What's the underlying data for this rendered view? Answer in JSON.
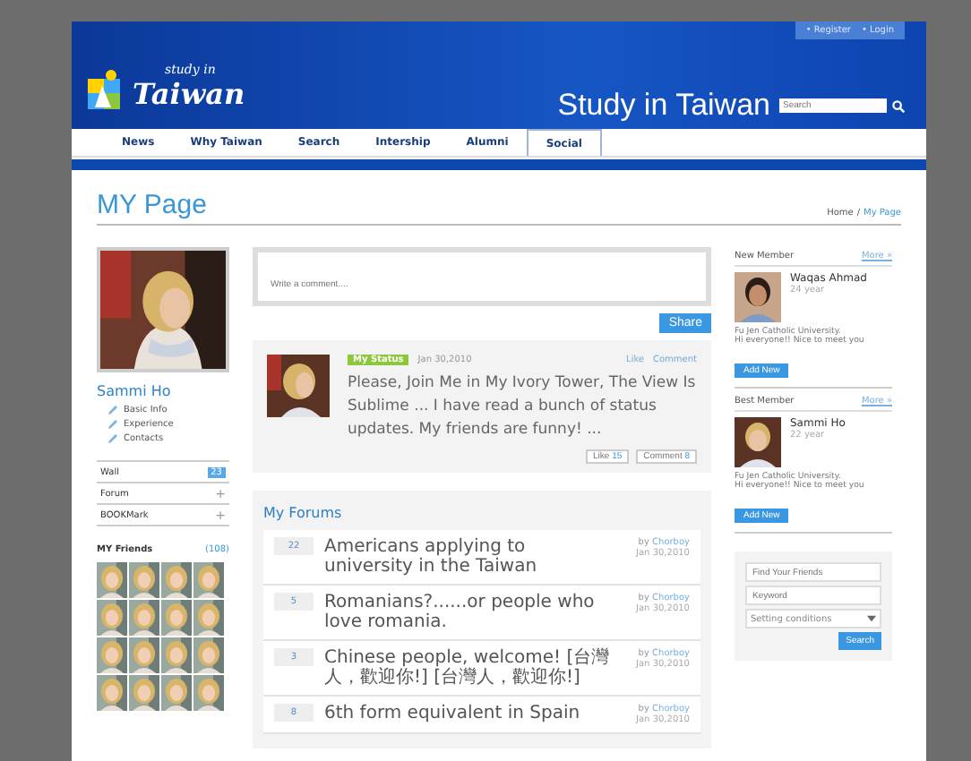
{
  "header": {
    "account_links": [
      "• Register",
      "• Login"
    ],
    "site_title": "Study in Taiwan",
    "logo_text": "Taiwan",
    "logo_small": "study in",
    "search": {
      "placeholder": "Search"
    }
  },
  "nav": [
    {
      "label": "News",
      "selected": false
    },
    {
      "label": "Why Taiwan",
      "selected": false
    },
    {
      "label": "Search",
      "selected": false
    },
    {
      "label": "Intership",
      "selected": false
    },
    {
      "label": "Alumni",
      "selected": false
    },
    {
      "label": "Social",
      "selected": true
    }
  ],
  "page_title": "MY Page",
  "breadcrumb": {
    "home": "Home",
    "separator": "/",
    "current": "My Page"
  },
  "profile": {
    "name": "Sammi Ho",
    "links": [
      "Basic Info",
      "Experience",
      "Contacts"
    ]
  },
  "menu": [
    {
      "label": "Wall",
      "kind": "badge",
      "badge": "23"
    },
    {
      "label": "Forum",
      "kind": "plus",
      "badge": "+"
    },
    {
      "label": "BOOKMark",
      "kind": "plus",
      "badge": "+"
    }
  ],
  "friends": {
    "label": "MY Friends",
    "count": "(108)"
  },
  "comment": {
    "placeholder": "Write a comment....",
    "button": "Share"
  },
  "status": {
    "tag": "My Status",
    "date": "Jan 30,2010",
    "like": "Like",
    "comment": "Comment",
    "text": "Please, Join Me in My Ivory Tower, The View Is Sublime ... I have read a bunch of status updates. My friends are funny! ...",
    "like_label": "Like",
    "like_count": "15",
    "comment_label": "Comment",
    "comment_count": "8"
  },
  "forums": {
    "title": "My Forums",
    "rows": [
      {
        "count": "22",
        "title": "Americans applying to university in the Taiwan",
        "by": "by",
        "author": "Chorboy",
        "date": "Jan 30,2010"
      },
      {
        "count": "5",
        "title": "Romanians?......or people who love romania.",
        "by": "by",
        "author": "Chorboy",
        "date": "Jan 30,2010"
      },
      {
        "count": "3",
        "title": "Chinese people, welcome! [台灣人，歡迎你!] [台灣人，歡迎你!]",
        "by": "by",
        "author": "Chorboy",
        "date": "Jan 30,2010"
      },
      {
        "count": "8",
        "title": "6th form equivalent in Spain",
        "by": "by",
        "author": "Chorboy",
        "date": "Jan 30,2010"
      }
    ]
  },
  "members": [
    {
      "heading": "New Member",
      "more": "More »",
      "name": "Waqas Ahmad",
      "age": "24 year",
      "school": "Fu Jen Catholic University.",
      "greeting": "Hi everyone!! Nice to meet you",
      "button": "Add New"
    },
    {
      "heading": "Best Member",
      "more": "More »",
      "name": "Sammi Ho",
      "age": "22 year",
      "school": "Fu Jen Catholic University.",
      "greeting": "Hi everyone!! Nice to meet you",
      "button": "Add New"
    }
  ],
  "finder": {
    "friends_placeholder": "Find Your Friends",
    "keyword_placeholder": "Keyword",
    "select_value": "Setting conditions",
    "button": "Search"
  }
}
